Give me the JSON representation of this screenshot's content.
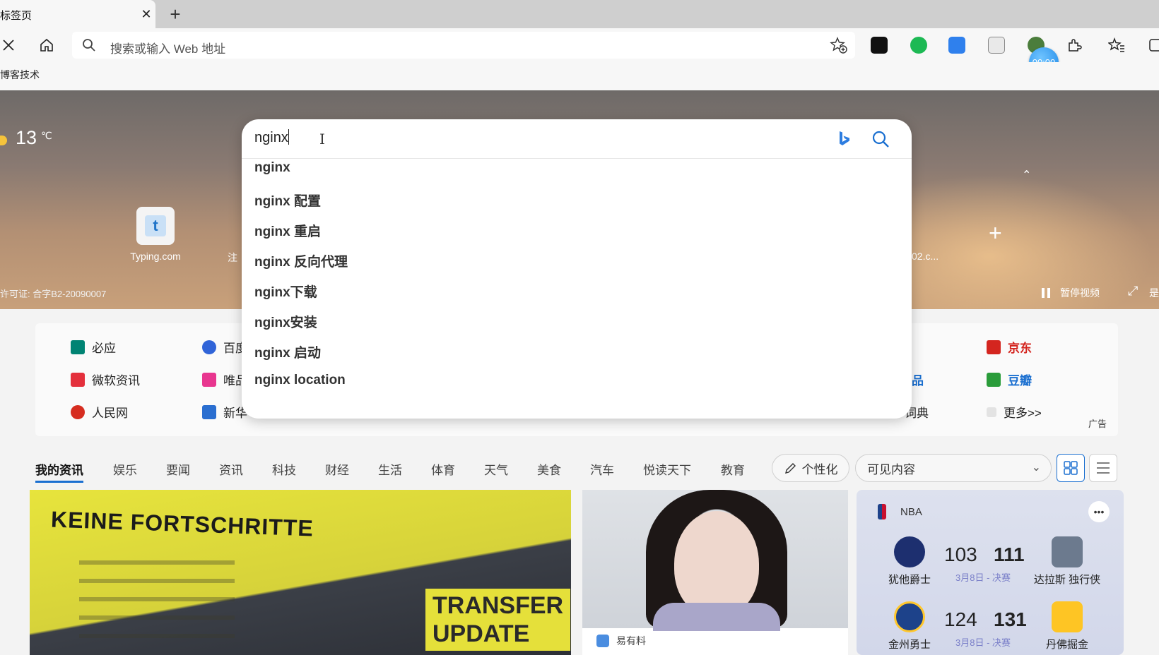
{
  "tab": {
    "title": "标签页"
  },
  "address_bar": {
    "placeholder": "搜索或输入 Web 地址"
  },
  "favorites_bar": {
    "item": "博客技术"
  },
  "timer": {
    "label": "00:00"
  },
  "hero": {
    "temperature": "13",
    "unit": "℃",
    "quick_links": [
      {
        "label": "Typing.com",
        "glyph": "t"
      }
    ],
    "partial_labels": {
      "left": "注",
      "right": "02.c..."
    },
    "license": "许可证: 合字B2-20090007",
    "pause_video": "暂停视频",
    "right_partial": "是"
  },
  "search": {
    "query": "nginx",
    "suggestions": [
      "nginx",
      "nginx 配置",
      "nginx 重启",
      "nginx 反向代理",
      "nginx下载",
      "nginx安装",
      "nginx 启动",
      "nginx location"
    ]
  },
  "links": {
    "col1": [
      "必应",
      "微软资讯",
      "人民网"
    ],
    "col2_partial": [
      "百度",
      "唯品",
      "新华"
    ],
    "col5_partial": [
      "品",
      "词典"
    ],
    "col6": [
      "京东",
      "豆瓣",
      "更多>>"
    ],
    "ad": "广告"
  },
  "feed": {
    "tabs": [
      "我的资讯",
      "娱乐",
      "要闻",
      "资讯",
      "科技",
      "财经",
      "生活",
      "体育",
      "天气",
      "美食",
      "汽车",
      "悦读天下",
      "教育"
    ],
    "personalize": "个性化",
    "visible_content": "可见内容"
  },
  "cards": {
    "big": {
      "headline": "KEINE FORTSCHRITTE",
      "overlay": "TRANSFER\nUPDATE"
    },
    "mid": {
      "source": "易有料"
    },
    "nba": {
      "title": "NBA",
      "games": [
        {
          "home": "犹他爵士",
          "home_score": "103",
          "away": "达拉斯 独行侠",
          "away_score": "111",
          "info": "3月8日 - 决赛"
        },
        {
          "home": "金州勇士",
          "home_score": "124",
          "away": "丹佛掘金",
          "away_score": "131",
          "info": "3月8日 - 决赛"
        }
      ]
    }
  },
  "colors": {
    "accent": "#1a6fd0",
    "red_link": "#d4251f"
  }
}
